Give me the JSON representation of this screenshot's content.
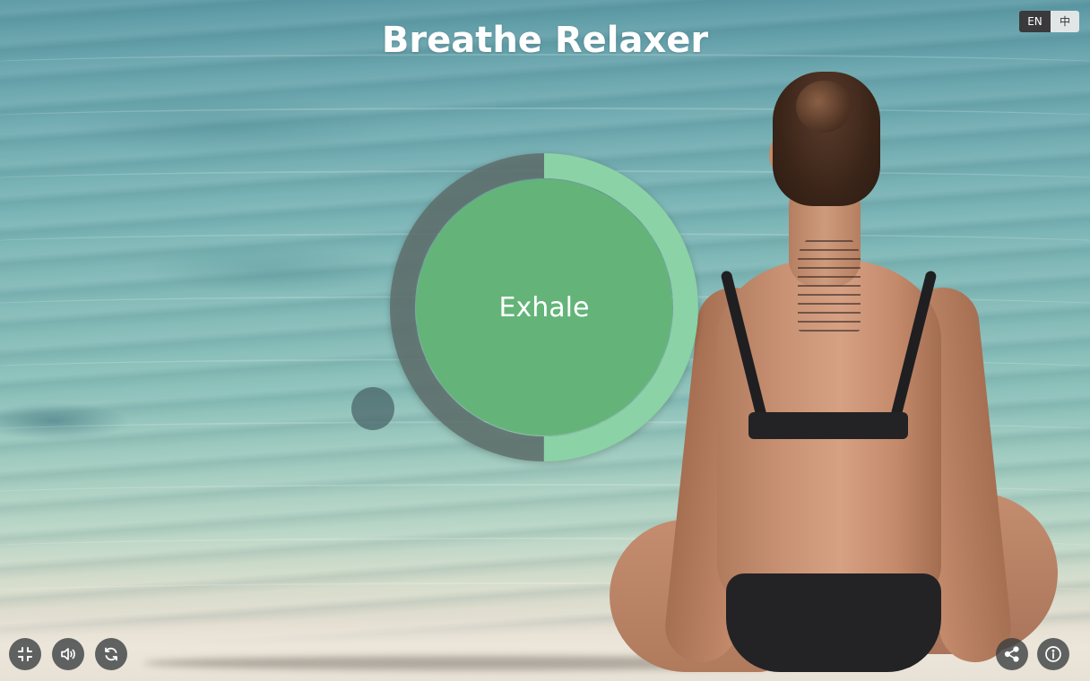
{
  "app": {
    "title": "Breathe Relaxer"
  },
  "language": {
    "en_label": "EN",
    "zh_label": "中",
    "active": "EN"
  },
  "breathing": {
    "phase_label": "Exhale",
    "progress": 0.5,
    "colors": {
      "fill": "#64b479",
      "progress": "#8bd2a6",
      "track": "#5e6e6b"
    }
  },
  "controls": {
    "left": [
      {
        "name": "fullscreen-exit-button",
        "icon": "fullscreen-exit-icon"
      },
      {
        "name": "sound-button",
        "icon": "speaker-icon"
      },
      {
        "name": "restart-button",
        "icon": "refresh-icon"
      }
    ],
    "right": [
      {
        "name": "share-button",
        "icon": "share-icon"
      },
      {
        "name": "info-button",
        "icon": "info-icon"
      }
    ]
  }
}
